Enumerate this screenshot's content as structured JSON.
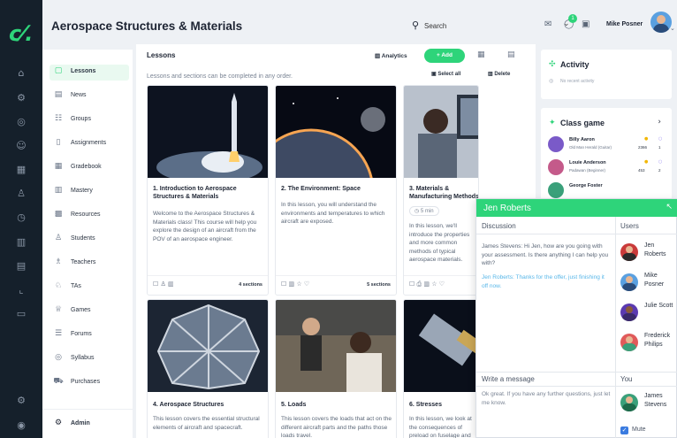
{
  "app": {
    "title": "Aerospace Structures & Materials"
  },
  "header": {
    "search_placeholder": "Search",
    "user_name": "Mike Posner",
    "notification_count": "1"
  },
  "sidebar": {
    "items": [
      {
        "label": "Lessons",
        "icon": "lessons-icon",
        "active": true
      },
      {
        "label": "News",
        "icon": "news-icon"
      },
      {
        "label": "Groups",
        "icon": "groups-icon"
      },
      {
        "label": "Assignments",
        "icon": "assignments-icon"
      },
      {
        "label": "Gradebook",
        "icon": "gradebook-icon"
      },
      {
        "label": "Mastery",
        "icon": "mastery-icon"
      },
      {
        "label": "Resources",
        "icon": "resources-icon"
      },
      {
        "label": "Students",
        "icon": "students-icon"
      },
      {
        "label": "Teachers",
        "icon": "teachers-icon"
      },
      {
        "label": "TAs",
        "icon": "tas-icon"
      },
      {
        "label": "Games",
        "icon": "games-icon"
      },
      {
        "label": "Forums",
        "icon": "forums-icon"
      },
      {
        "label": "Syllabus",
        "icon": "syllabus-icon"
      },
      {
        "label": "Purchases",
        "icon": "purchases-icon"
      }
    ],
    "admin_label": "Admin"
  },
  "main": {
    "title": "Lessons",
    "subtitle": "Lessons and sections can be completed in any order.",
    "analytics_label": "Analytics",
    "add_label": "+ Add",
    "select_all_label": "Select all",
    "delete_label": "Delete",
    "lessons": [
      {
        "title": "1. Introduction to Aerospace Structures & Materials",
        "desc": "Welcome to the Aerospace Structures & Materials class! This course will help you explore the design of an aircraft from the POV of an aerospace engineer.",
        "sections": "4 sections"
      },
      {
        "title": "2. The Environment: Space",
        "desc": "In this lesson, you will understand the environments and temperatures to which aircraft are exposed.",
        "sections": "5 sections"
      },
      {
        "title": "3. Materials & Manufacturing Methods",
        "badge": "5 min",
        "desc": "In this lesson, we'll introduce the properties and more common methods of typical aerospace materials."
      },
      {
        "title": "4. Aerospace Structures",
        "desc": "This lesson covers the essential structural elements of aircraft and spacecraft."
      },
      {
        "title": "5. Loads",
        "desc": "This lesson covers the loads that act on the different aircraft parts and the paths those loads travel."
      },
      {
        "title": "6. Stresses",
        "desc": "In this lesson, we look at the consequences of preload on fuselage and other structures."
      }
    ]
  },
  "activity": {
    "title": "Activity",
    "empty_text": "No recent activity"
  },
  "class_game": {
    "title": "Class game",
    "rows": [
      {
        "name": "Billy Aaron",
        "sub": "Old Man Herald (Guitar)",
        "points": "2366",
        "rank": "1"
      },
      {
        "name": "Louie Anderson",
        "sub": "Padawan (Beginner)",
        "points": "453",
        "rank": "2"
      },
      {
        "name": "George Foster",
        "sub": "",
        "points": "",
        "rank": ""
      }
    ]
  },
  "chat": {
    "contact": "Jen Roberts",
    "discussion_label": "Discussion",
    "users_label": "Users",
    "msg_them": "James Stevens: Hi Jen, how are you going with your assessment. Is there anything I can help you with?",
    "msg_me": "Jen Roberts: Thanks for the offer, just finishing it off now.",
    "write_label": "Write a message",
    "you_label": "You",
    "draft": "Ok great. If you have any further questions, just let me know.",
    "users": [
      {
        "name": "Jen Roberts"
      },
      {
        "name": "Mike Posner"
      },
      {
        "name": "Julie Scott"
      },
      {
        "name": "Frederick Philips"
      }
    ],
    "you_name": "James Stevens",
    "mute_label": "Mute"
  }
}
